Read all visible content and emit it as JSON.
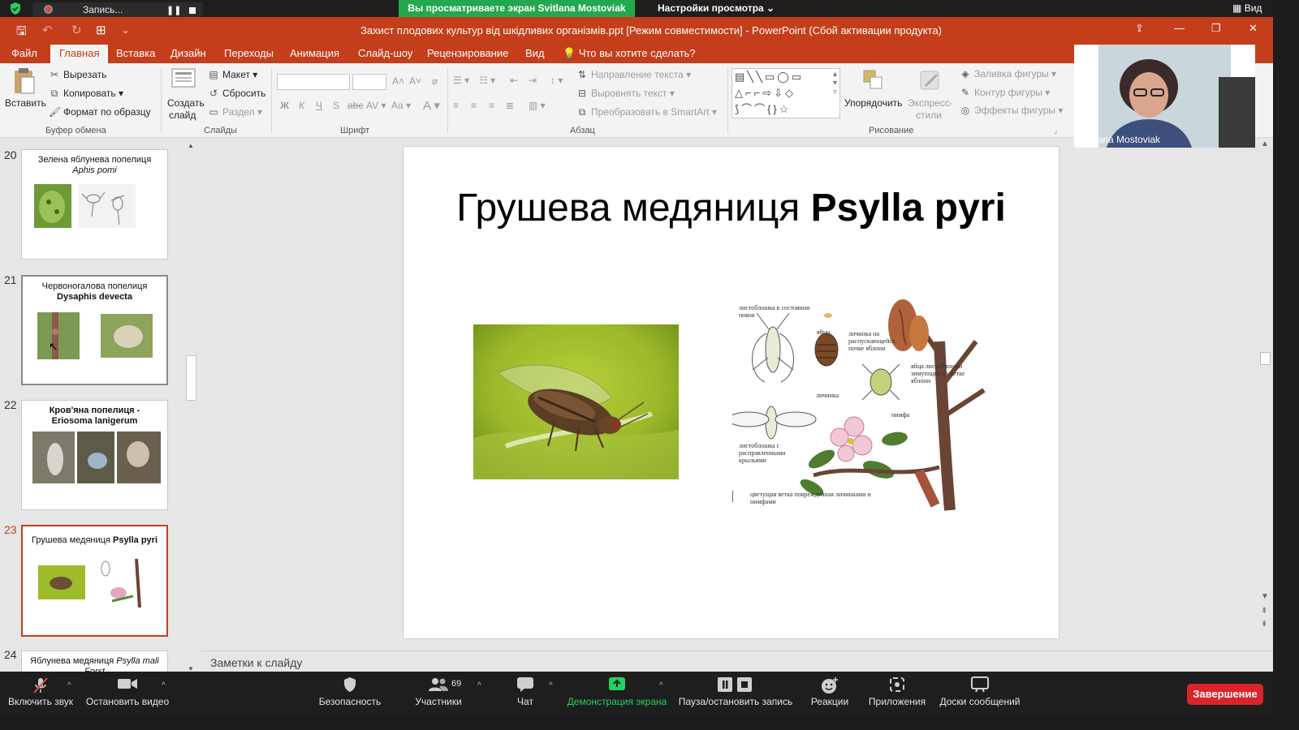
{
  "zoom_top": {
    "recording_label": "Запись...",
    "viewing_banner": "Вы просматриваете экран Svitlana Mostoviak",
    "view_options": "Настройки просмотра",
    "view_button": "Вид"
  },
  "ppt": {
    "doc_title": "Захист плодових культур від шкідливих організмів.ppt [Режим совместимости] - PowerPoint (Сбой активации продукта)",
    "tabs": [
      "Файл",
      "Главная",
      "Вставка",
      "Дизайн",
      "Переходы",
      "Анимация",
      "Слайд-шоу",
      "Рецензирование",
      "Вид"
    ],
    "tell_me": "Что вы хотите сделать?"
  },
  "ribbon": {
    "paste": "Вставить",
    "cut": "Вырезать",
    "copy": "Копировать",
    "format_painter": "Формат по образцу",
    "clipboard_group": "Буфер обмена",
    "new_slide_1": "Создать",
    "new_slide_2": "слайд",
    "layout": "Макет",
    "reset": "Сбросить",
    "section": "Раздел",
    "slides_group": "Слайды",
    "font_group": "Шрифт",
    "text_direction": "Направление текста",
    "align_text": "Выровнять текст",
    "smartart": "Преобразовать в SmartArt",
    "paragraph_group": "Абзац",
    "arrange": "Упорядочить",
    "quick_styles_1": "Экспресс-",
    "quick_styles_2": "стили",
    "shape_fill": "Заливка фигуры",
    "shape_outline": "Контур фигуры",
    "shape_effects": "Эффекты фигуры",
    "drawing_group": "Рисование"
  },
  "thumbnails": [
    {
      "num": "20",
      "title": "Зелена яблунева попелиця",
      "subtitle": "Aphis pomi"
    },
    {
      "num": "21",
      "title": "Червоногалова попелиця",
      "subtitle": "Dysaphis devecta"
    },
    {
      "num": "22",
      "title": "Кров'яна попелиця -",
      "subtitle": "Eriosoma lanigerum"
    },
    {
      "num": "23",
      "title": "Грушева медяниця",
      "subtitle": "Psylla pyri"
    },
    {
      "num": "24",
      "title": "Яблунева медяниця",
      "subtitle": "Psylla mali Forst"
    }
  ],
  "slide": {
    "title_plain": "Грушева медяниця ",
    "title_bold": "Psylla pyri",
    "plate_labels": [
      "листоблошка в состоянии покоя",
      "яйцо",
      "личинка на распускающейся почке яблони",
      "яйца листоблошки зимующие на ветке яблони",
      "личинка",
      "нимфа",
      "листоблошка с расправленными крыльями",
      "цветущая ветка поврежденная личинками и нимфами"
    ]
  },
  "notes_placeholder": "Заметки к слайду",
  "video": {
    "participant_name": "Svitlana Mostoviak"
  },
  "zoom_bottom": {
    "unmute": "Включить звук",
    "stop_video": "Остановить видео",
    "security": "Безопасность",
    "participants": "Участники",
    "participants_count": "69",
    "chat": "Чат",
    "share_screen": "Демонстрация экрана",
    "pause_record": "Пауза/остановить запись",
    "reactions": "Реакции",
    "apps": "Приложения",
    "whiteboards": "Доски сообщений",
    "end": "Завершение"
  },
  "colors": {
    "ppt_accent": "#c43e1c",
    "zoom_green": "#23a84e",
    "zoom_end": "#d9252a"
  }
}
